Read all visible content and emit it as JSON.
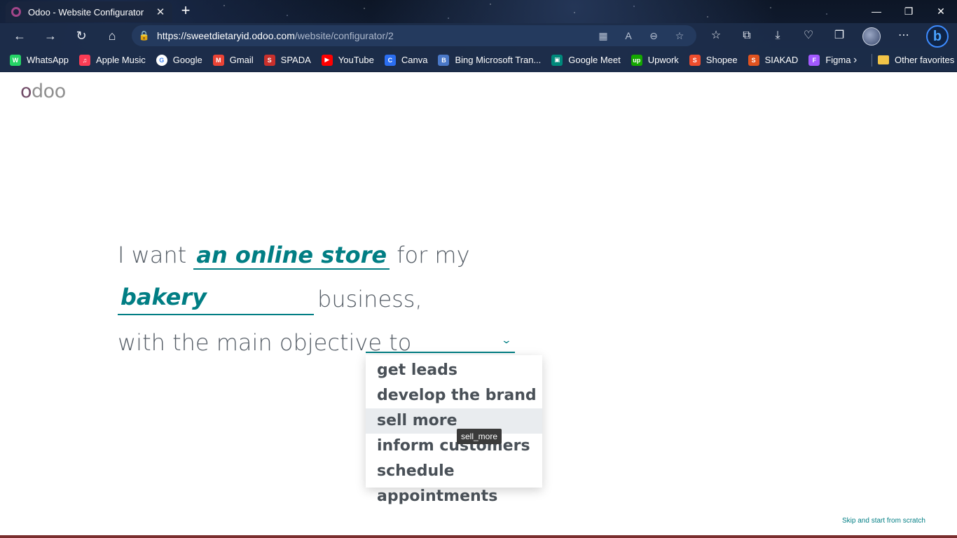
{
  "tab": {
    "title": "Odoo - Website Configurator",
    "close": "✕",
    "new_tab": "+"
  },
  "window": {
    "minimize": "—",
    "restore": "❐",
    "close": "✕"
  },
  "nav": {
    "back": "←",
    "forward": "→",
    "reload": "↻",
    "home": "⌂"
  },
  "address": {
    "lock": "🔒",
    "host": "https://sweetdietaryid.odoo.com",
    "path": "/website/configurator/2"
  },
  "bookmarks": [
    {
      "label": "WhatsApp",
      "color": "#25d366",
      "glyph": "W"
    },
    {
      "label": "Apple Music",
      "color": "#fa3c55",
      "glyph": "♫"
    },
    {
      "label": "Google",
      "color": "#ffffff",
      "glyph": "G"
    },
    {
      "label": "Gmail",
      "color": "#ea4335",
      "glyph": "M"
    },
    {
      "label": "SPADA",
      "color": "#c9302c",
      "glyph": "S"
    },
    {
      "label": "YouTube",
      "color": "#ff0000",
      "glyph": "▶"
    },
    {
      "label": "Canva",
      "color": "#2b6ef0",
      "glyph": "C"
    },
    {
      "label": "Bing Microsoft Tran...",
      "color": "#4a78c8",
      "glyph": "B"
    },
    {
      "label": "Google Meet",
      "color": "#00897b",
      "glyph": "▣"
    },
    {
      "label": "Upwork",
      "color": "#14a800",
      "glyph": "up"
    },
    {
      "label": "Shopee",
      "color": "#ee4d2d",
      "glyph": "S"
    },
    {
      "label": "SIAKAD",
      "color": "#e0531f",
      "glyph": "S"
    },
    {
      "label": "Figma",
      "color": "#a259ff",
      "glyph": "F"
    }
  ],
  "bookmarks_more": "›",
  "other_favorites": "Other favorites",
  "logo": {
    "o": "o",
    "rest": "doo"
  },
  "sentence": {
    "part1": "I want",
    "website_type": "an online store",
    "part2": "for my",
    "industry": "bakery",
    "part3": "business,",
    "part4": "with the main objective to"
  },
  "objective_options": [
    "get leads",
    "develop the brand",
    "sell more",
    "inform customers",
    "schedule appointments"
  ],
  "hovered_option": "sell more",
  "tooltip": "sell_more",
  "skip_link": "Skip and start from scratch",
  "colors": {
    "accent": "#017e84",
    "brand": "#714b67"
  }
}
